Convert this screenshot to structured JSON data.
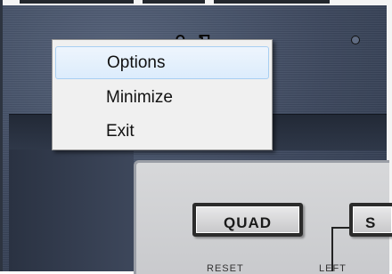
{
  "app": {
    "logo_text": "ideo",
    "buttons": {
      "quad": "QUAD",
      "s": "S"
    },
    "labels": {
      "reset": "RESET",
      "left": "LEFT"
    }
  },
  "context_menu": {
    "items": [
      {
        "label": "Options",
        "highlighted": true
      },
      {
        "label": "Minimize",
        "highlighted": false
      },
      {
        "label": "Exit",
        "highlighted": false
      }
    ]
  },
  "colors": {
    "skin": "#3c475d",
    "panel": "#d0d1d3",
    "menu_bg": "#f0f0f0",
    "menu_highlight": "#dcecfc"
  }
}
